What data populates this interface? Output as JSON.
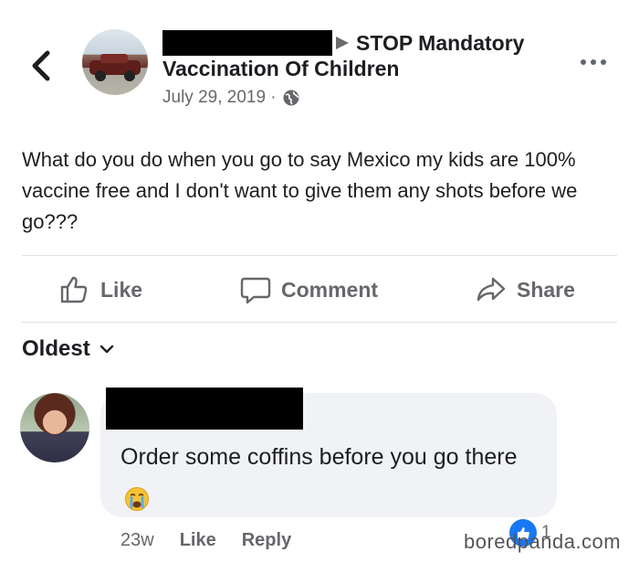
{
  "post": {
    "group_line1": "STOP Mandatory",
    "group_line2": "Vaccination Of Children",
    "date": "July 29, 2019 ·",
    "body": "What do you do when you go to say Mexico my kids are 100% vaccine free and I don't want to give them any shots before we go???"
  },
  "actions": {
    "like": "Like",
    "comment": "Comment",
    "share": "Share"
  },
  "comments_sort": "Oldest",
  "comment": {
    "text": "Order some coffins before you go there",
    "time": "23w",
    "like": "Like",
    "reply": "Reply",
    "like_count": "1"
  },
  "icons": {
    "back": "chevron-left-icon",
    "more": "more-dots-icon",
    "globe": "globe-icon",
    "like": "thumbs-up-icon",
    "comment": "speech-bubble-icon",
    "share": "share-arrow-icon",
    "sort": "chevron-down-icon",
    "reaction": "crying-face-emoji"
  },
  "colors": {
    "text": "#1c1e21",
    "muted": "#65676b",
    "bubble": "#f0f2f5",
    "like_blue": "#1877f2"
  },
  "watermark": "boredpanda.com"
}
